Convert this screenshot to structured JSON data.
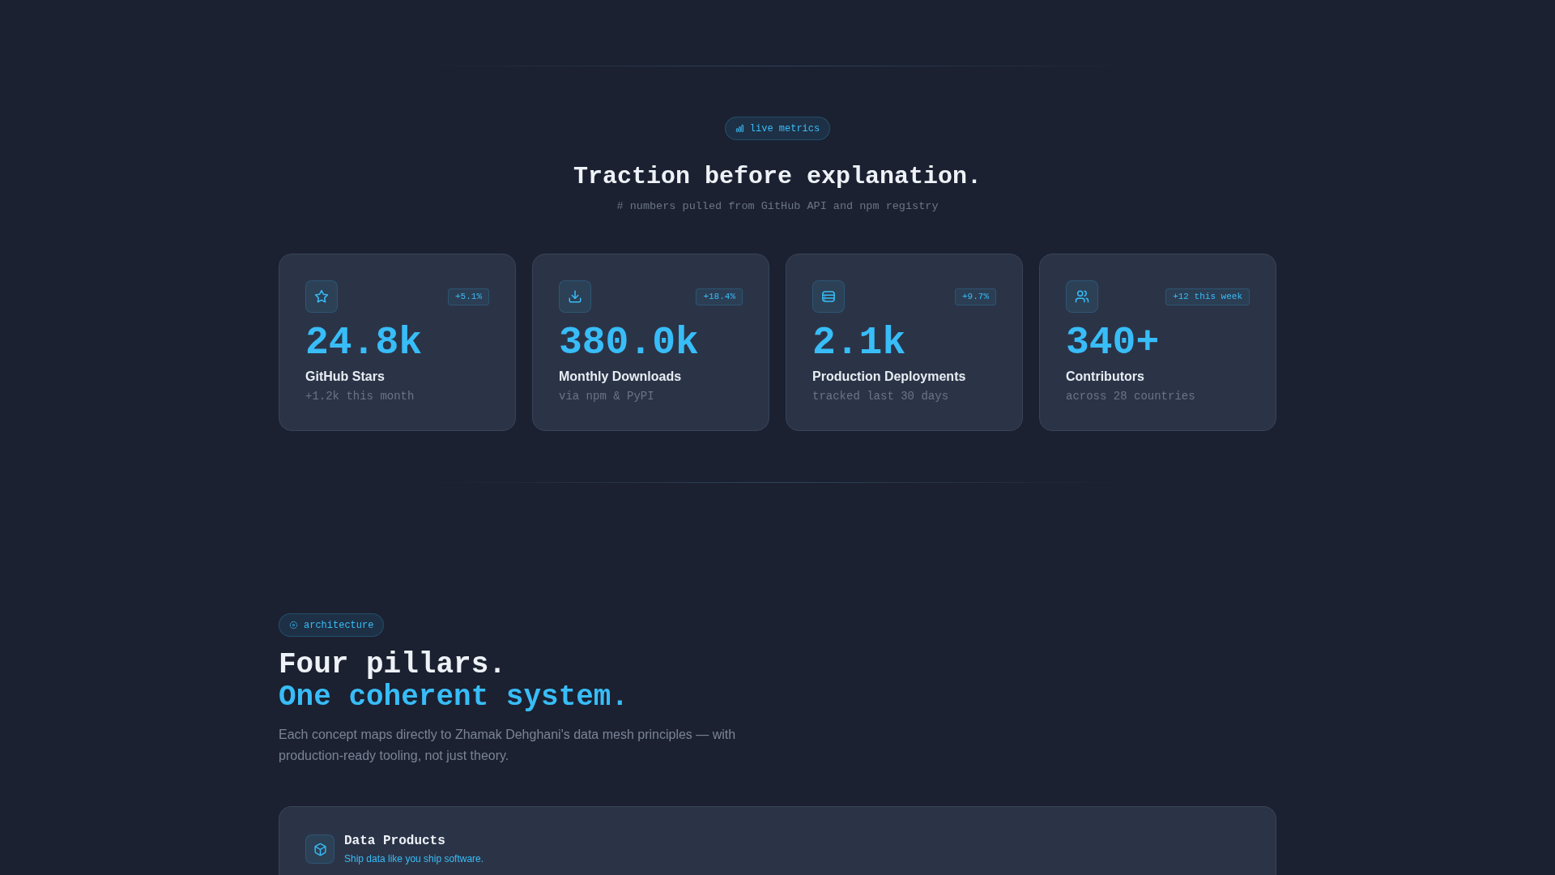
{
  "metrics": {
    "tag": {
      "label": "live metrics"
    },
    "title": "Traction before explanation.",
    "subtitle": "# numbers pulled from GitHub API and npm registry",
    "cards": [
      {
        "change": "+5.1%",
        "value": "24.8k",
        "label": "GitHub Stars",
        "note": "+1.2k this month"
      },
      {
        "change": "+18.4%",
        "value": "380.0k",
        "label": "Monthly Downloads",
        "note": "via npm & PyPI"
      },
      {
        "change": "+9.7%",
        "value": "2.1k",
        "label": "Production Deployments",
        "note": "tracked last 30 days"
      },
      {
        "change": "+12 this week",
        "value": "340+",
        "label": "Contributors",
        "note": "across 28 countries"
      }
    ]
  },
  "architecture": {
    "tag": {
      "label": "architecture"
    },
    "title": "Four pillars.",
    "title_accent": "One coherent system.",
    "description": "Each concept maps directly to Zhamak Dehghani's data mesh principles — with production-ready tooling, not just theory.",
    "pillars": [
      {
        "title": "Data Products",
        "tagline": "Ship data like you ship software."
      }
    ]
  }
}
